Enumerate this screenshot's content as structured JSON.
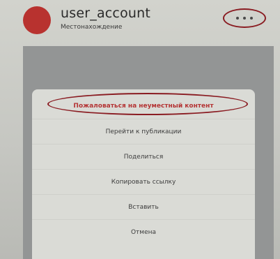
{
  "header": {
    "username": "user_account",
    "location": "Местонахождение"
  },
  "menu": {
    "items": [
      {
        "label": "Пожаловаться на неуместный контент"
      },
      {
        "label": "Перейти к публикации"
      },
      {
        "label": "Поделиться"
      },
      {
        "label": "Копировать ссылку"
      },
      {
        "label": "Вставить"
      },
      {
        "label": "Отмена"
      }
    ]
  },
  "colors": {
    "avatar": "#b8322f",
    "annotation": "#8a1c22",
    "danger_text": "#b43434"
  }
}
